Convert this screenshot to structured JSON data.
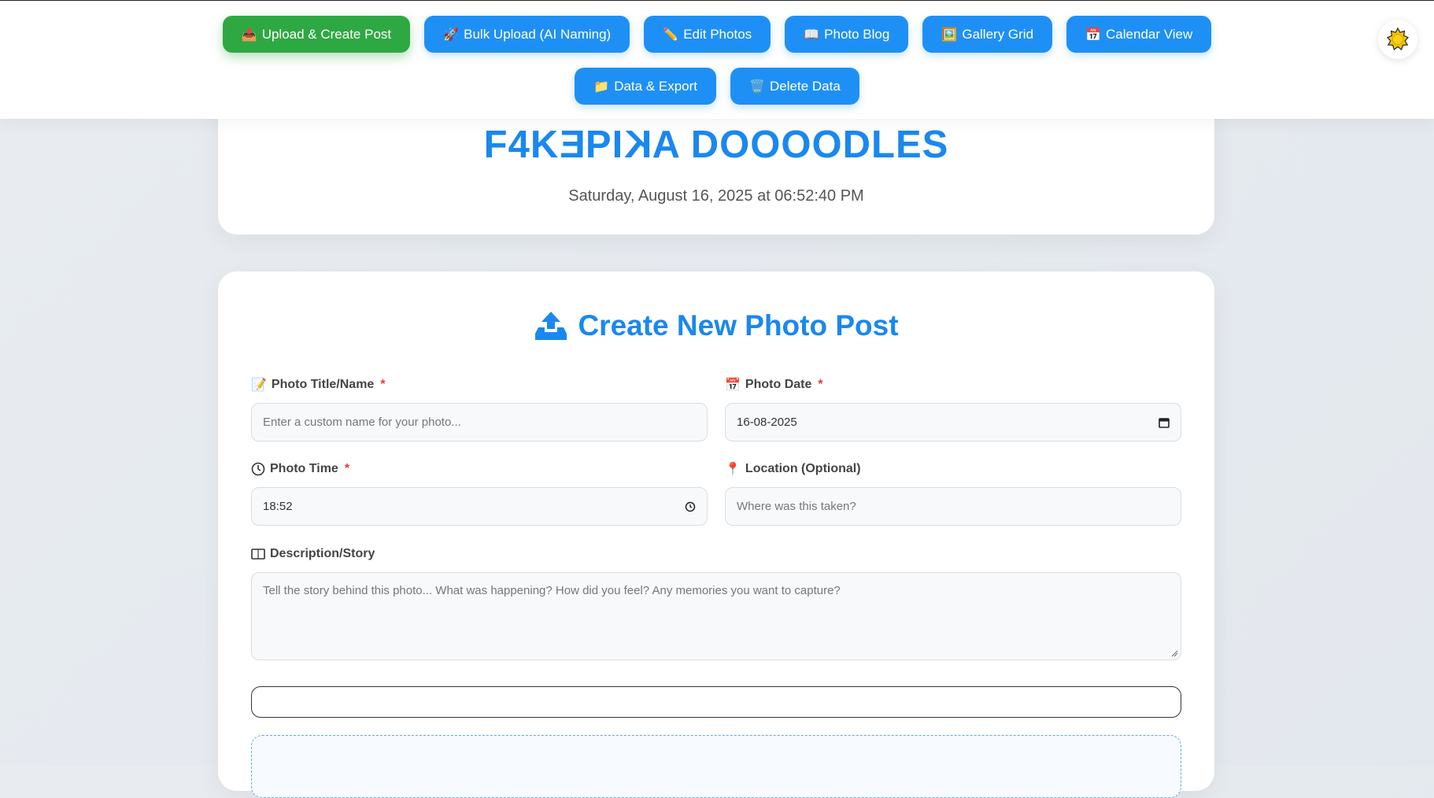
{
  "nav": {
    "row1": [
      {
        "icon": "📤",
        "label": "Upload & Create Post",
        "active": true
      },
      {
        "icon": "🚀",
        "label": "Bulk Upload (AI Naming)",
        "active": false
      },
      {
        "icon": "✏️",
        "label": "Edit Photos",
        "active": false
      },
      {
        "icon": "📖",
        "label": "Photo Blog",
        "active": false
      },
      {
        "icon": "🖼️",
        "label": "Gallery Grid",
        "active": false
      },
      {
        "icon": "📅",
        "label": "Calendar View",
        "active": false
      }
    ],
    "row2": [
      {
        "icon": "📁",
        "label": "Data & Export",
        "active": false
      },
      {
        "icon": "🗑️",
        "label": "Delete Data",
        "active": false
      }
    ]
  },
  "header": {
    "title_part1": "F4K",
    "title_rev1": "E",
    "title_part2": "PI",
    "title_rev2": "K",
    "title_part3": "A DOOOODLES",
    "datetime": "Saturday, August 16, 2025 at 06:52:40 PM"
  },
  "form": {
    "title": "Create New Photo Post",
    "photo_title": {
      "label": "Photo Title/Name",
      "placeholder": "Enter a custom name for your photo...",
      "required_mark": "*"
    },
    "photo_date": {
      "label": "Photo Date",
      "value": "16-08-2025",
      "required_mark": "*"
    },
    "photo_time": {
      "label": "Photo Time",
      "value": "18:52",
      "required_mark": "*"
    },
    "location": {
      "label": "Location (Optional)",
      "placeholder": "Where was this taken?"
    },
    "description": {
      "label": "Description/Story",
      "placeholder": "Tell the story behind this photo... What was happening? How did you feel? Any memories you want to capture?"
    }
  },
  "colors": {
    "primary": "#1e90f5",
    "active": "#2ea843",
    "title": "#1a88ee",
    "required": "#e53935"
  }
}
